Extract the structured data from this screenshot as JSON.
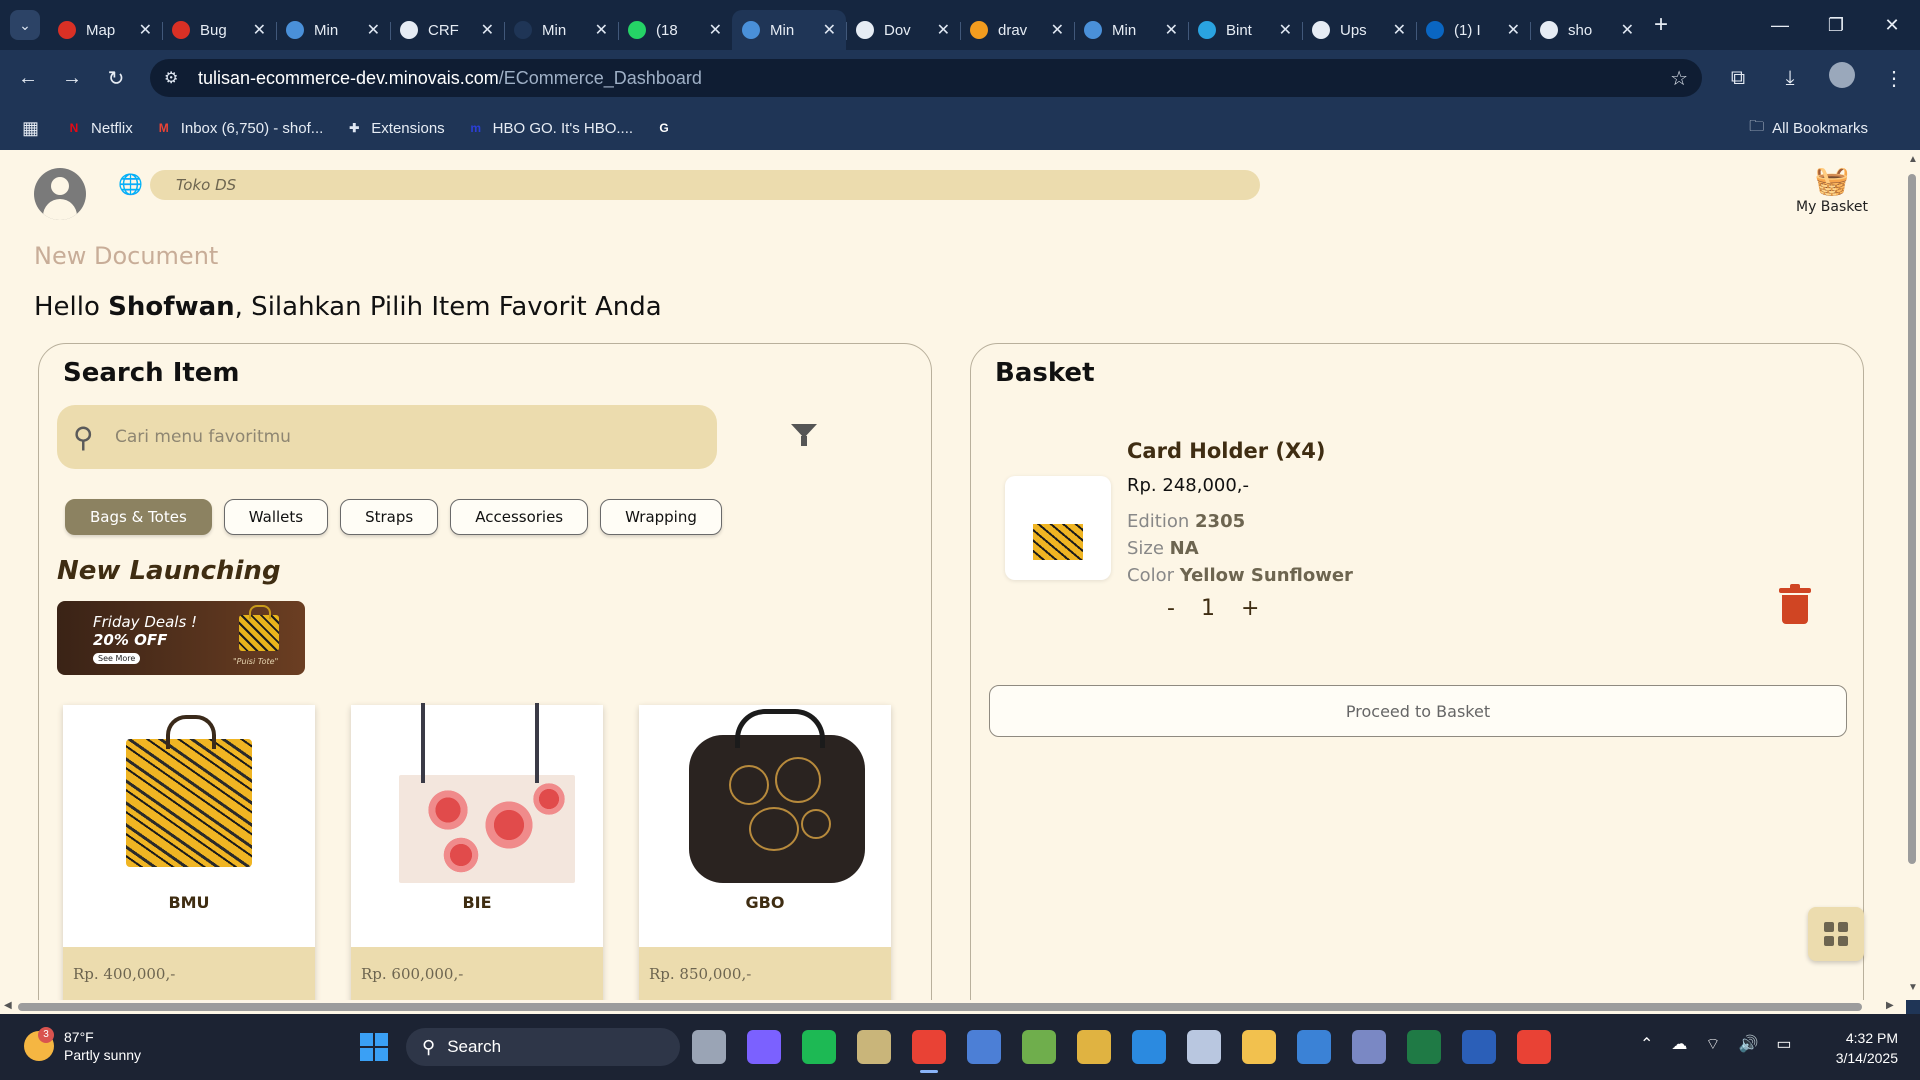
{
  "browser": {
    "tabs": [
      {
        "title": "Map",
        "icon_color": "#d93025",
        "icon": "arc-icon"
      },
      {
        "title": "Bug",
        "icon_color": "#d93025",
        "icon": "arc-icon"
      },
      {
        "title": "Min",
        "icon_color": "#4a90d9",
        "icon": "app-icon"
      },
      {
        "title": "CRF",
        "icon_color": "#e6ecf4",
        "icon": "globe-icon"
      },
      {
        "title": "Min",
        "icon_color": "#1f3556",
        "icon": "dot-icon"
      },
      {
        "title": "(18",
        "icon_color": "#25d366",
        "icon": "whatsapp-icon"
      },
      {
        "title": "Min",
        "icon_color": "#4a90d9",
        "icon": "cube-icon"
      },
      {
        "title": "Dov",
        "icon_color": "#e6ecf4",
        "icon": "download-icon"
      },
      {
        "title": "drav",
        "icon_color": "#f29c1f",
        "icon": "drawio-icon"
      },
      {
        "title": "Min",
        "icon_color": "#4a90d9",
        "icon": "cube-icon"
      },
      {
        "title": "Bint",
        "icon_color": "#2aa3e0",
        "icon": "telegram-icon"
      },
      {
        "title": "Ups",
        "icon_color": "#e6ecf4",
        "icon": "upwork-icon"
      },
      {
        "title": "(1) I",
        "icon_color": "#0a66c2",
        "icon": "linkedin-icon"
      },
      {
        "title": "sho",
        "icon_color": "#e6ecf4",
        "icon": "github-icon"
      }
    ],
    "active_tab_index": 6,
    "url_host": "tulisan-ecommerce-dev.minovais.com",
    "url_path": "/ECommerce_Dashboard",
    "bookmarks": [
      {
        "label": "Netflix",
        "icon_color": "#e50914",
        "icon": "N"
      },
      {
        "label": "Inbox (6,750) - shof...",
        "icon_color": "#ea4335",
        "icon": "M"
      },
      {
        "label": "Extensions",
        "icon_color": "#dfe7f2",
        "icon": "✚"
      },
      {
        "label": "HBO GO. It's HBO....",
        "icon_color": "#2b3fd6",
        "icon": "m"
      },
      {
        "label": "",
        "icon_color": "#ffffff",
        "icon": "G"
      }
    ],
    "all_bookmarks": "All Bookmarks"
  },
  "header": {
    "store_name": "Toko DS",
    "basket_label": "My Basket"
  },
  "page": {
    "doc_title": "New Document",
    "greeting_prefix": "Hello ",
    "user_name": "Shofwan",
    "greeting_suffix": ", Silahkan Pilih Item Favorit Anda"
  },
  "search_panel": {
    "title": "Search Item",
    "search_placeholder": "Cari menu favoritmu",
    "categories": [
      "Bags & Totes",
      "Wallets",
      "Straps",
      "Accessories",
      "Wrapping"
    ],
    "active_category": "Bags & Totes",
    "section_title": "New Launching",
    "banner": {
      "line1": "Friday Deals !",
      "line2": "20% OFF",
      "cta": "See More",
      "caption": "\"Puisi Tote\""
    },
    "products": [
      {
        "name": "BMU",
        "price": "Rp.  400,000,-"
      },
      {
        "name": "BIE",
        "price": "Rp.  600,000,-"
      },
      {
        "name": "GBO",
        "price": "Rp.  850,000,-"
      }
    ]
  },
  "basket_panel": {
    "title": "Basket",
    "item": {
      "name": "Card Holder (X4)",
      "price": "Rp. 248,000,-",
      "edition_label": "Edition ",
      "edition": "2305",
      "size_label": "Size ",
      "size": "NA",
      "color_label": "Color ",
      "color": "Yellow Sunflower",
      "qty_minus": "-",
      "quantity": "1",
      "qty_plus": "+"
    },
    "proceed_label": "Proceed to Basket"
  },
  "taskbar": {
    "temperature": "87°F",
    "weather": "Partly sunny",
    "weather_badge": "3",
    "search_label": "Search",
    "time": "4:32 PM",
    "date": "3/14/2025",
    "apps": [
      {
        "name": "task-view-icon",
        "color": "#9aa4b5"
      },
      {
        "name": "copilot-icon",
        "color": "#7b61ff"
      },
      {
        "name": "spotify-icon",
        "color": "#1db954"
      },
      {
        "name": "tools-icon",
        "color": "#c9b57a"
      },
      {
        "name": "chrome-icon",
        "color": "#e94235"
      },
      {
        "name": "remote-desktop-icon",
        "color": "#4c7fd6"
      },
      {
        "name": "image-viewer-icon",
        "color": "#6fae4c"
      },
      {
        "name": "paint-icon",
        "color": "#e0b341"
      },
      {
        "name": "vscode-icon",
        "color": "#2b8ae0"
      },
      {
        "name": "notepad-icon",
        "color": "#b9c7e0"
      },
      {
        "name": "file-explorer-icon",
        "color": "#f2c14e"
      },
      {
        "name": "notes-icon",
        "color": "#3b82d6"
      },
      {
        "name": "link-icon",
        "color": "#7a88c4"
      },
      {
        "name": "excel-icon",
        "color": "#1f7a45"
      },
      {
        "name": "word-icon",
        "color": "#2b5fb8"
      },
      {
        "name": "chrome-profile-icon",
        "color": "#e94235"
      }
    ]
  }
}
